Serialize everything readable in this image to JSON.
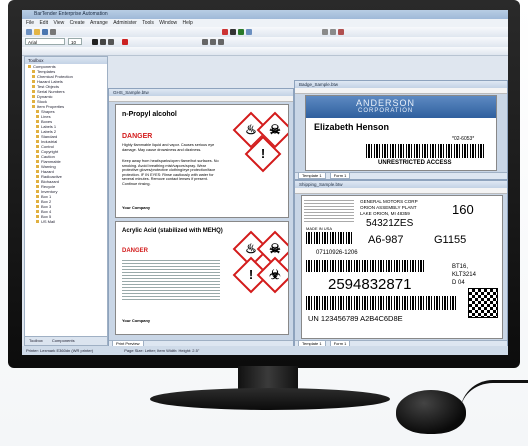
{
  "app": {
    "title": "BarTender Enterprise Automation",
    "menu": [
      "File",
      "Edit",
      "View",
      "Create",
      "Arrange",
      "Administer",
      "Tools",
      "Window",
      "Help"
    ],
    "font_name": "Arial",
    "font_size": "10"
  },
  "sidebar": {
    "header": "Toolbox",
    "items": [
      "Components",
      "Templates",
      "Chemical Protection",
      "Hazard Labels",
      "Test Objects",
      "Serial Numbers",
      "Dynamic",
      "Stock",
      "Item Properties",
      "Shapes",
      "Lines",
      "Boxes",
      "Labels 1",
      "Labels 2",
      "Standard",
      "Industrial",
      "Control",
      "Copyright",
      "Caution",
      "Flammable",
      "Warning",
      "Hazard",
      "Radioactive",
      "Biohazard",
      "Recycle",
      "Inventory",
      "Box 1",
      "Box 2",
      "Box 3",
      "Box 4",
      "Box 5",
      "US Mail"
    ],
    "tabs": [
      "Toolbox",
      "Components"
    ]
  },
  "doc1": {
    "title": "GHS_Sample.btw",
    "label1": {
      "product": "n-Propyl alcohol",
      "signal": "DANGER",
      "hazard_text": "Highly flammable liquid and vapor. Causes serious eye damage. May cause drowsiness and dizziness.",
      "precaution_text": "Keep away from heat/sparks/open flame/hot surfaces. No smoking. Avoid breathing mist/vapors/spray. Wear protective gloves/protective clothing/eye protection/face protection. IF IN EYES: Rinse cautiously with water for several minutes. Remove contact lenses if present. Continue rinsing.",
      "company": "Your Company"
    },
    "label2": {
      "product": "Acrylic Acid (stabilized with MEHQ)",
      "signal": "DANGER",
      "company": "Your Company"
    },
    "tabs": [
      "Print Preview"
    ]
  },
  "doc2": {
    "title": "Badge_Sample.btw",
    "org_line1": "ANDERSON",
    "org_line2": "CORPORATION",
    "name": "Elizabeth Henson",
    "id": "*02-6053*",
    "access": "UNRESTRICTED ACCESS",
    "tabs": [
      "Template 1",
      "Form 1"
    ]
  },
  "doc3": {
    "title": "Shipping_Sample.btw",
    "from_label": "GENERAL MOTORS CORP",
    "from_line2": "ORION ASSEMBLY PLANT",
    "from_line3": "LAKE ORION, MI 48359",
    "made_in": "MADE IN USA",
    "part_no": "54321ZES",
    "qty": "160",
    "code1": "A6-987",
    "code2": "G1155",
    "date_code": "07110926-1206",
    "serial": "2594832871",
    "bt1": "BT16,",
    "bt2": "KLT3214",
    "bt3": "D 04",
    "un_code": "UN 123456789 A2B4C6D8E",
    "tabs": [
      "Template 1",
      "Form 1"
    ]
  },
  "status": {
    "text": "Printer: Lexmark E360dn (WR printer)",
    "page_info": "Page Size: Letter; Item Width: Height: 2.5\""
  }
}
